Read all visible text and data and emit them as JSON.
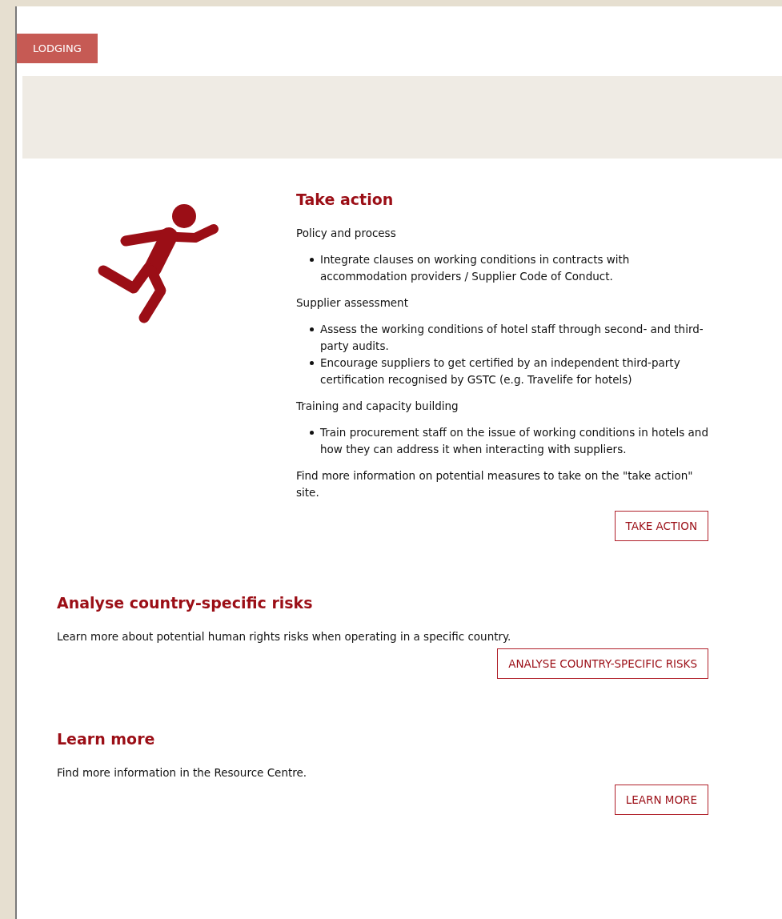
{
  "category_tag": "LODGING",
  "take_action": {
    "title": "Take action",
    "groups": [
      {
        "heading": "Policy and process",
        "items": [
          "Integrate clauses on working conditions in contracts with accommodation providers / Supplier Code of Conduct."
        ]
      },
      {
        "heading": "Supplier assessment",
        "items": [
          "Assess the working conditions of hotel staff through second- and third-party audits.",
          "Encourage suppliers to get certified by an independent third-party certification recognised by GSTC (e.g. Travelife for hotels)"
        ]
      },
      {
        "heading": "Training and capacity building",
        "items": [
          "Train procurement staff on the issue of working conditions in hotels and how they can address it when interacting with suppliers."
        ]
      }
    ],
    "footer": "Find more information on potential measures to take on the \"take action\" site.",
    "button": "TAKE ACTION"
  },
  "sections": [
    {
      "title": "Analyse country-specific risks",
      "text": "Learn more about potential human rights risks when operating in a specific country.",
      "button": "ANALYSE COUNTRY-SPECIFIC RISKS"
    },
    {
      "title": "Learn more",
      "text": "Find more information in the Resource Centre.",
      "button": "LEARN MORE"
    }
  ]
}
